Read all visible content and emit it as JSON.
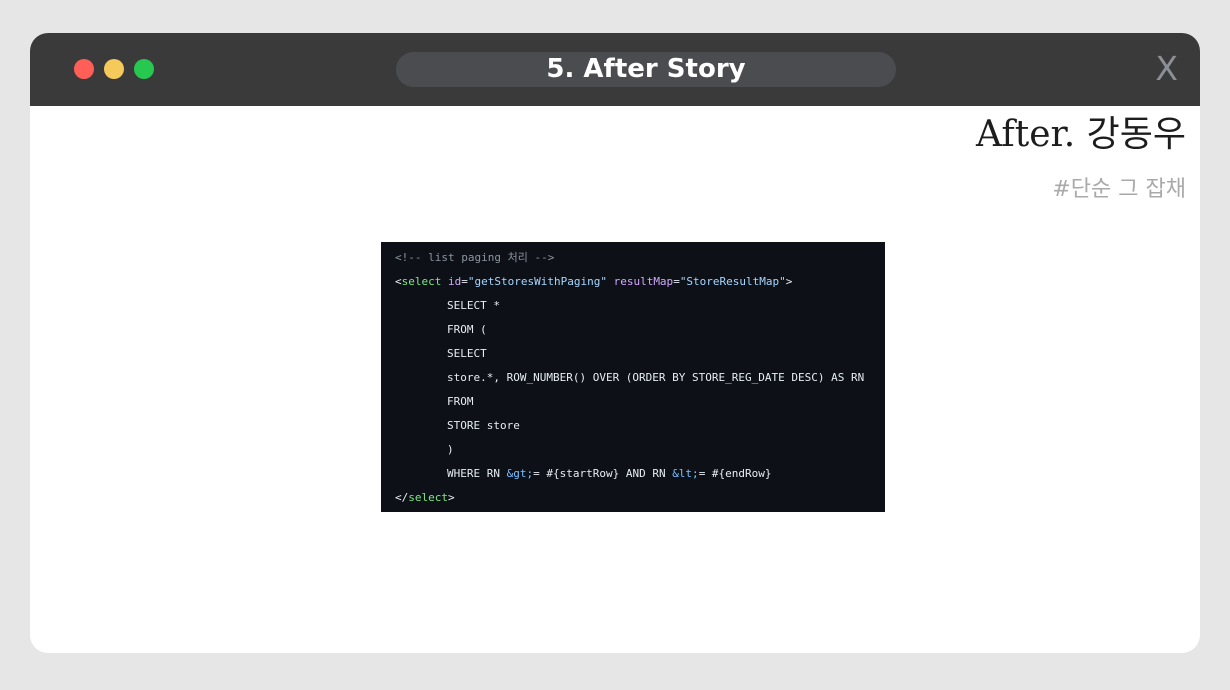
{
  "window": {
    "title": "5. After Story",
    "close_label": "X",
    "controls": {
      "close_color": "#ff5f57",
      "minimize_color": "#f5ca5b",
      "maximize_color": "#27c84f"
    }
  },
  "content": {
    "heading": "After. 강동우",
    "tagline": "#단순 그 잡채"
  },
  "code": {
    "comment": "<!-- list paging 처리 -->",
    "open_lt": "<",
    "open_tag": "select",
    "space": " ",
    "attr_id": "id",
    "eq": "=",
    "val_id": "\"getStoresWithPaging\"",
    "attr_map": "resultMap",
    "val_map": "\"StoreResultMap\"",
    "gt": ">",
    "line_select_star": "SELECT *",
    "line_from_paren": "FROM (",
    "line_select": "SELECT",
    "line_store_cols": "store.*, ROW_NUMBER() OVER (ORDER BY STORE_REG_DATE DESC) AS RN",
    "line_from": "FROM",
    "line_store_table": "STORE store",
    "line_close_paren": ")",
    "where_part1": "WHERE RN ",
    "where_ent_gt": "&gt;",
    "where_part2": "= #{startRow} AND RN ",
    "where_ent_lt": "&lt;",
    "where_part3": "= #{endRow}",
    "close_lt": "</",
    "close_tag": "select",
    "close_gt": ">"
  }
}
